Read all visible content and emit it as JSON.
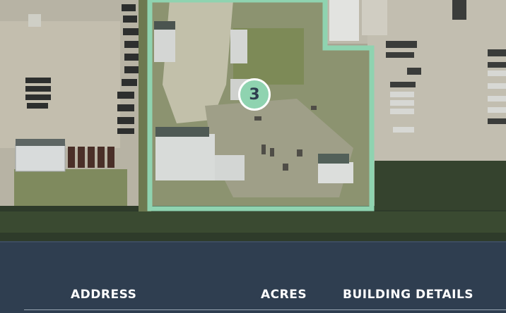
{
  "map": {
    "parcel": {
      "label": "3",
      "outline_color": "#8fd3b0",
      "badge_color": "#8fd3b0"
    },
    "terrain_colors": {
      "grass": "#6f7d52",
      "dirt": "#b9b59a",
      "trees": "#2c3a27",
      "pavement": "#c7c3b6",
      "roof": "#d9dcdc"
    }
  },
  "table": {
    "headers": {
      "address": "ADDRESS",
      "acres": "ACRES",
      "building_details": "BUILDING DETAILS"
    },
    "header_text_color": "#ffffff",
    "background_color": "#2f3e50"
  }
}
